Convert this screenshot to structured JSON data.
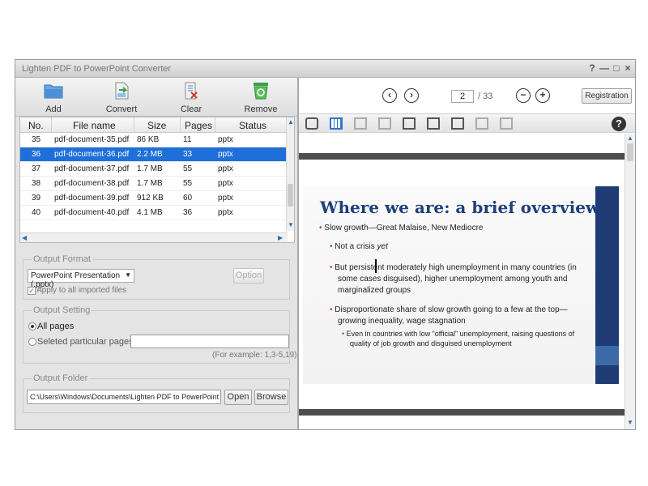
{
  "window": {
    "title": "Lighten PDF to PowerPoint Converter",
    "controls": [
      "?",
      "—",
      "□",
      "×"
    ]
  },
  "toolbar": {
    "add_label": "Add",
    "convert_label": "Convert",
    "clear_label": "Clear",
    "remove_label": "Remove"
  },
  "table": {
    "headers": [
      "No.",
      "File name",
      "Size",
      "Pages",
      "Status"
    ],
    "rows": [
      {
        "no": "35",
        "name": "pdf-document-35.pdf",
        "size": "86 KB",
        "pages": "11",
        "status": "pptx"
      },
      {
        "no": "36",
        "name": "pdf-document-36.pdf",
        "size": "2.2 MB",
        "pages": "33",
        "status": "pptx"
      },
      {
        "no": "37",
        "name": "pdf-document-37.pdf",
        "size": "1.7 MB",
        "pages": "55",
        "status": "pptx"
      },
      {
        "no": "38",
        "name": "pdf-document-38.pdf",
        "size": "1.7 MB",
        "pages": "55",
        "status": "pptx"
      },
      {
        "no": "39",
        "name": "pdf-document-39.pdf",
        "size": "912 KB",
        "pages": "60",
        "status": "pptx"
      },
      {
        "no": "40",
        "name": "pdf-document-40.pdf",
        "size": "4.1 MB",
        "pages": "36",
        "status": "pptx"
      }
    ],
    "selected_index": 1
  },
  "output_format": {
    "title": "Output Format",
    "selected": "PowerPoint Presentation (.pptx)",
    "option_label": "Option",
    "apply_all_label": "Apply to all imported files"
  },
  "output_setting": {
    "title": "Output Setting",
    "all_pages_label": "All pages",
    "particular_label": "Seleted particular pages",
    "example": "(For example: 1,3-5,19)"
  },
  "output_folder": {
    "title": "Output Folder",
    "path": "C:\\Users\\Windows\\Documents\\Lighten PDF to PowerPoint Conver",
    "open_label": "Open",
    "browse_label": "Browse"
  },
  "viewer": {
    "current_page": "2",
    "total_pages": "/ 33",
    "registration_label": "Registration",
    "prev_icon": "prev-icon",
    "next_icon": "next-icon",
    "zoom_out_icon": "zoom-out-icon",
    "zoom_in_icon": "zoom-in-icon"
  },
  "slide": {
    "title": "Where we are:  a brief overview",
    "l1": "Slow growth—Great Malaise, New Mediocre",
    "l2a": "Not a crisis ",
    "l2b": "yet",
    "l3": "But persistent moderately high unemployment in many countries (in some cases disguised), higher unemployment among youth and marginalized groups",
    "l4": "Disproportionate share of slow growth going to a few at the top—growing inequality, wage stagnation",
    "l5": "Even in countries with low “official” unemployment, raising questions of quality of job growth and disguised unemployment"
  },
  "colors": {
    "selection": "#1e6fd9",
    "slide_title": "#1f3f7a",
    "slide_band": "#1f3b73",
    "bullet": "#c0392b"
  }
}
